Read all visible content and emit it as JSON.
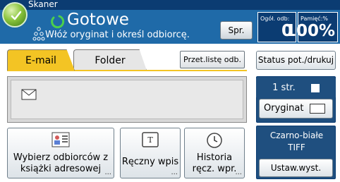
{
  "header": {
    "app_title": "Skaner",
    "status": "Gotowe",
    "message": "Włóż oryginat i określ odbiorcę.",
    "spr_button": "Spr.",
    "counter": {
      "label": "Ogół. odb:",
      "value": "0"
    },
    "memory": {
      "label": "Pamięć:%",
      "value": "100%"
    }
  },
  "tabs": [
    {
      "label": "E-mail",
      "active": true
    },
    {
      "label": "Folder",
      "active": false
    }
  ],
  "dest_list_button": "Przet.listę odb.",
  "buttons": {
    "address_book": "Wybierz odbiorców z książki adresowej",
    "manual_entry": "Ręczny wpis",
    "history": "Historia ręcz. wpr."
  },
  "right": {
    "status_button": "Status pot./drukuj",
    "pages": "1 str.",
    "original": "Oryginat",
    "color_mode_line1": "Czarno-białe",
    "color_mode_line2": "TIFF",
    "scan_settings": "Ustaw.wyst."
  },
  "icons": {
    "logo": "scanner-logo-icon",
    "status": "ready-icon",
    "people": "people-icon",
    "envelope": "envelope-icon",
    "address_book": "address-book-icon",
    "manual_entry": "text-entry-icon",
    "history": "clock-icon"
  },
  "colors": {
    "header_bg": "#1f6aa8",
    "active_tab": "#f3c424",
    "right_panel": "#1f4f7f"
  }
}
